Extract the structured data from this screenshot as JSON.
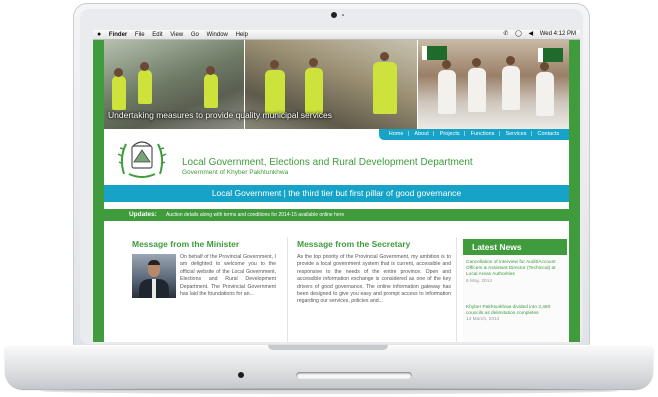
{
  "menubar": {
    "items": [
      "Finder",
      "File",
      "Edit",
      "View",
      "Go",
      "Window",
      "Help"
    ],
    "clock": "Wed 4:12 PM"
  },
  "banner": {
    "caption": "Undertaking measures to provide quality municipal services"
  },
  "nav": {
    "items": [
      "Home",
      "About",
      "Projects",
      "Functions",
      "Services",
      "Contacts"
    ],
    "separator": "|"
  },
  "header": {
    "title": "Local Government, Elections and Rural Development Department",
    "subtitle": "Government of Khyber Pakhtunkhwa"
  },
  "tagline": "Local Government | the third tier but first pillar of good governance",
  "updates": {
    "label": "Updates:",
    "text": "Auction details along with terms and conditions for 2014-15 available online here"
  },
  "minister": {
    "title": "Message from the Minister",
    "text": "On behalf of the Provincial Government, I am delighted to welcome you to the official website of the Local Government, Elections and Rural Development Department. The Provincial Government has laid the foundations for an..."
  },
  "secretary": {
    "title": "Message from the Secretary",
    "text": "As the top priority of the Provincial Government, my ambition is to provide a local government system that is current, accessible and responsive to the needs of the entire province. Open and accessible information exchange is considered as one of the key drivers of good governance. The online information gateway has been designed to give you easy and prompt access to information regarding our services, policies and..."
  },
  "news": {
    "title": "Latest News",
    "items": [
      {
        "text": "Cancellation of interview for Audit/Account Officers & Assistant Director (Technical) at Local Areas Authorities",
        "date": "6 May, 2014"
      },
      {
        "text": "Khyber Pakhtunkhwa divided into 3,480 councils as delimitation completes",
        "date": "14 March, 2014"
      }
    ]
  },
  "colors": {
    "green": "#3f9b3c",
    "blue": "#17a3c8"
  }
}
